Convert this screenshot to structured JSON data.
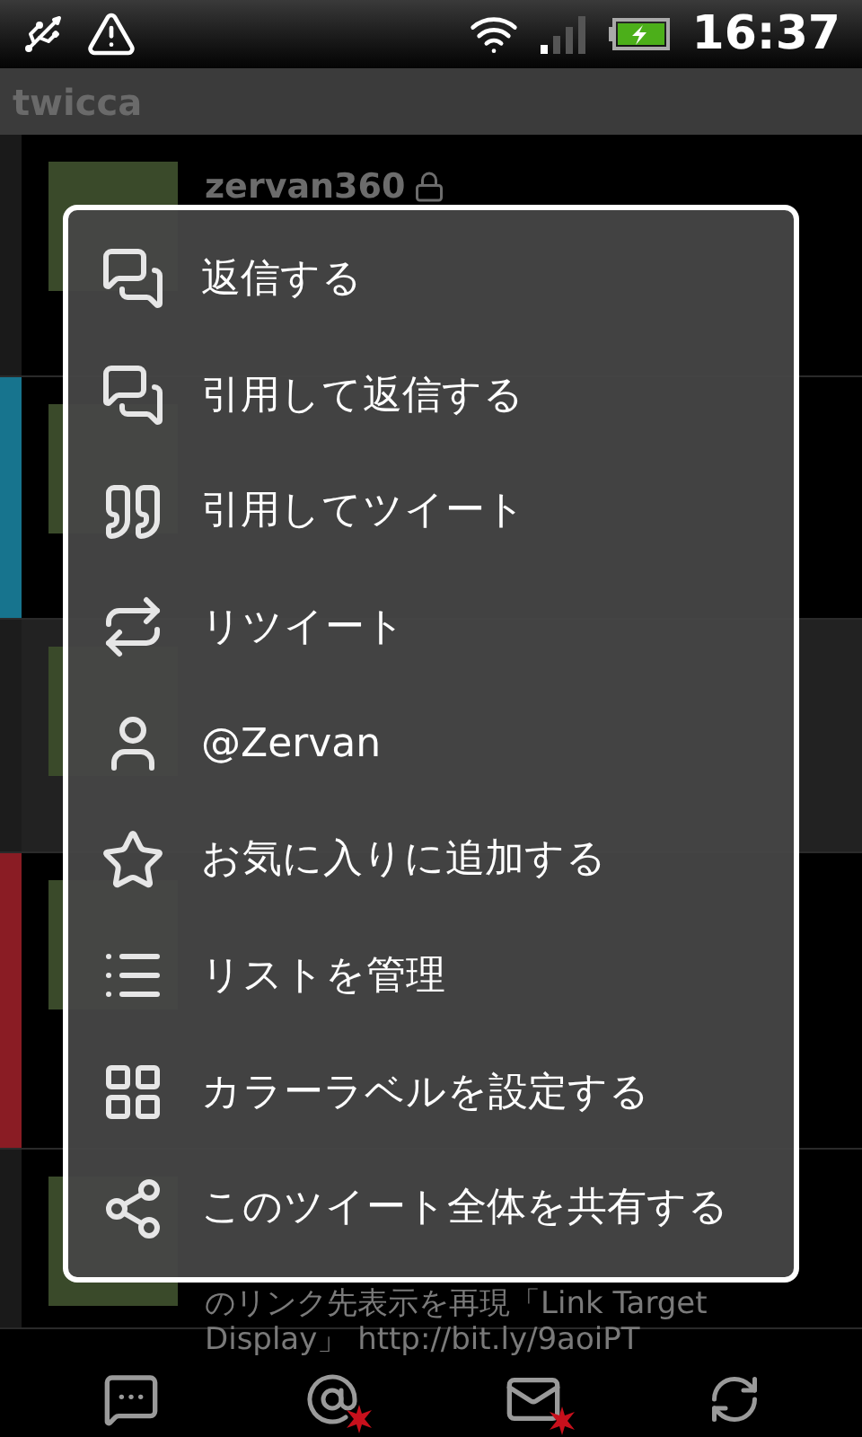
{
  "status_bar": {
    "time": "16:37"
  },
  "app_bar": {
    "title": "twicca"
  },
  "timeline": [
    {
      "color": "#1a1a1a",
      "selected": false,
      "user": "zervan360",
      "locked": true
    },
    {
      "color": "#17748e",
      "selected": false
    },
    {
      "color": "#1c1c1c",
      "selected": true
    },
    {
      "color": "#8a1c24",
      "selected": false
    },
    {
      "color": "#1a1a1a",
      "selected": false,
      "lines": [
        "のリンク先表示を再現「Link Target",
        "Display」 http://bit.ly/9aoiPT"
      ]
    }
  ],
  "context_menu": {
    "items": [
      "返信する",
      "引用して返信する",
      "引用してツイート",
      "リツイート",
      "@Zervan",
      "お気に入りに追加する",
      "リストを管理",
      "カラーラベルを設定する",
      "このツイート全体を共有する"
    ]
  }
}
